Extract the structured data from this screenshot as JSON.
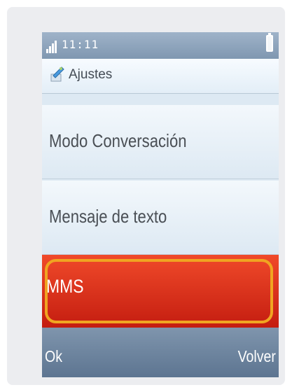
{
  "status_bar": {
    "time": "11:11",
    "signal_icon": "signal-strength-icon",
    "battery_icon": "battery-icon"
  },
  "header": {
    "title": "Ajustes",
    "icon": "settings-tools-icon"
  },
  "menu": {
    "items": [
      {
        "label": "Modo Conversación",
        "selected": false
      },
      {
        "label": "Mensaje de texto",
        "selected": false
      },
      {
        "label": "MMS",
        "selected": true
      }
    ]
  },
  "softkeys": {
    "left": "Ok",
    "right": "Volver"
  },
  "colors": {
    "selection": "#e0301a",
    "highlight_ring": "#f0a521",
    "status_bar": "#8aa1b9",
    "softkey_bar": "#6e859f"
  }
}
